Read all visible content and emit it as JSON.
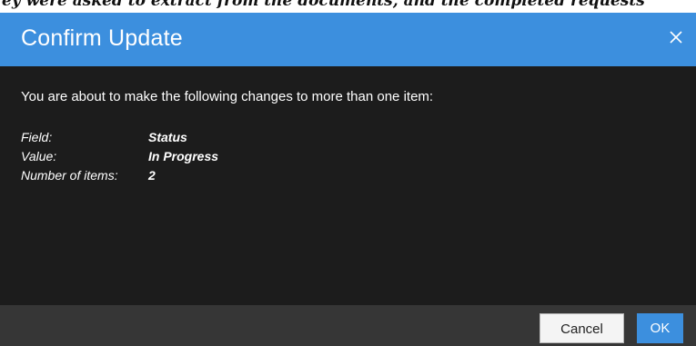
{
  "background_text": "ey were asked to extract from the documents, and the completed requests",
  "dialog": {
    "title": "Confirm Update",
    "close_icon": "close-icon",
    "intro": "You are about to make the following changes to more than one item:",
    "fields": [
      {
        "label": "Field:",
        "value": "Status"
      },
      {
        "label": "Value:",
        "value": "In Progress"
      },
      {
        "label": "Number of items:",
        "value": "2"
      }
    ],
    "buttons": {
      "cancel": "Cancel",
      "ok": "OK"
    }
  },
  "colors": {
    "header": "#3c8fde",
    "body": "#1c1c1c",
    "footer": "#363636",
    "ok_button": "#3c8fde"
  }
}
